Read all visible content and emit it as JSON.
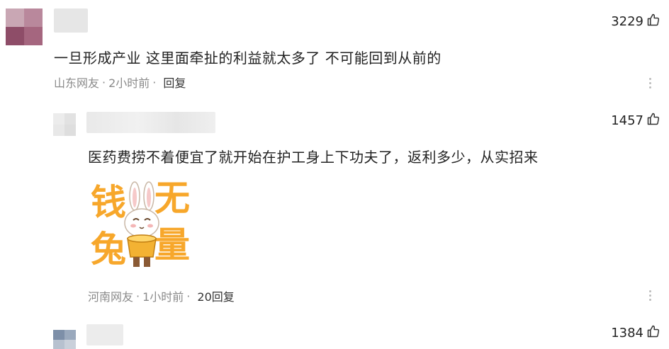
{
  "comments": [
    {
      "likes": "3229",
      "text": "一旦形成产业 这里面牵扯的利益就太多了 不可能回到从前的",
      "location": "山东网友",
      "time": "2小时前",
      "reply": "回复"
    },
    {
      "likes": "1457",
      "text": "医药费捞不着便宜了就开始在护工身上下功夫了，返利多少，从实招来",
      "location": "河南网友",
      "time": "1小时前",
      "reply": "20回复",
      "sticker": {
        "chars": [
          "钱",
          "无",
          "兔",
          "量"
        ]
      }
    },
    {
      "likes": "1384"
    }
  ],
  "separator": "·",
  "colors": {
    "accent_sticker": "#f7a72b",
    "meta_text": "#8a8a8a"
  },
  "icons": {
    "like": "thumbs-up-icon",
    "more": "more-vertical-icon"
  }
}
